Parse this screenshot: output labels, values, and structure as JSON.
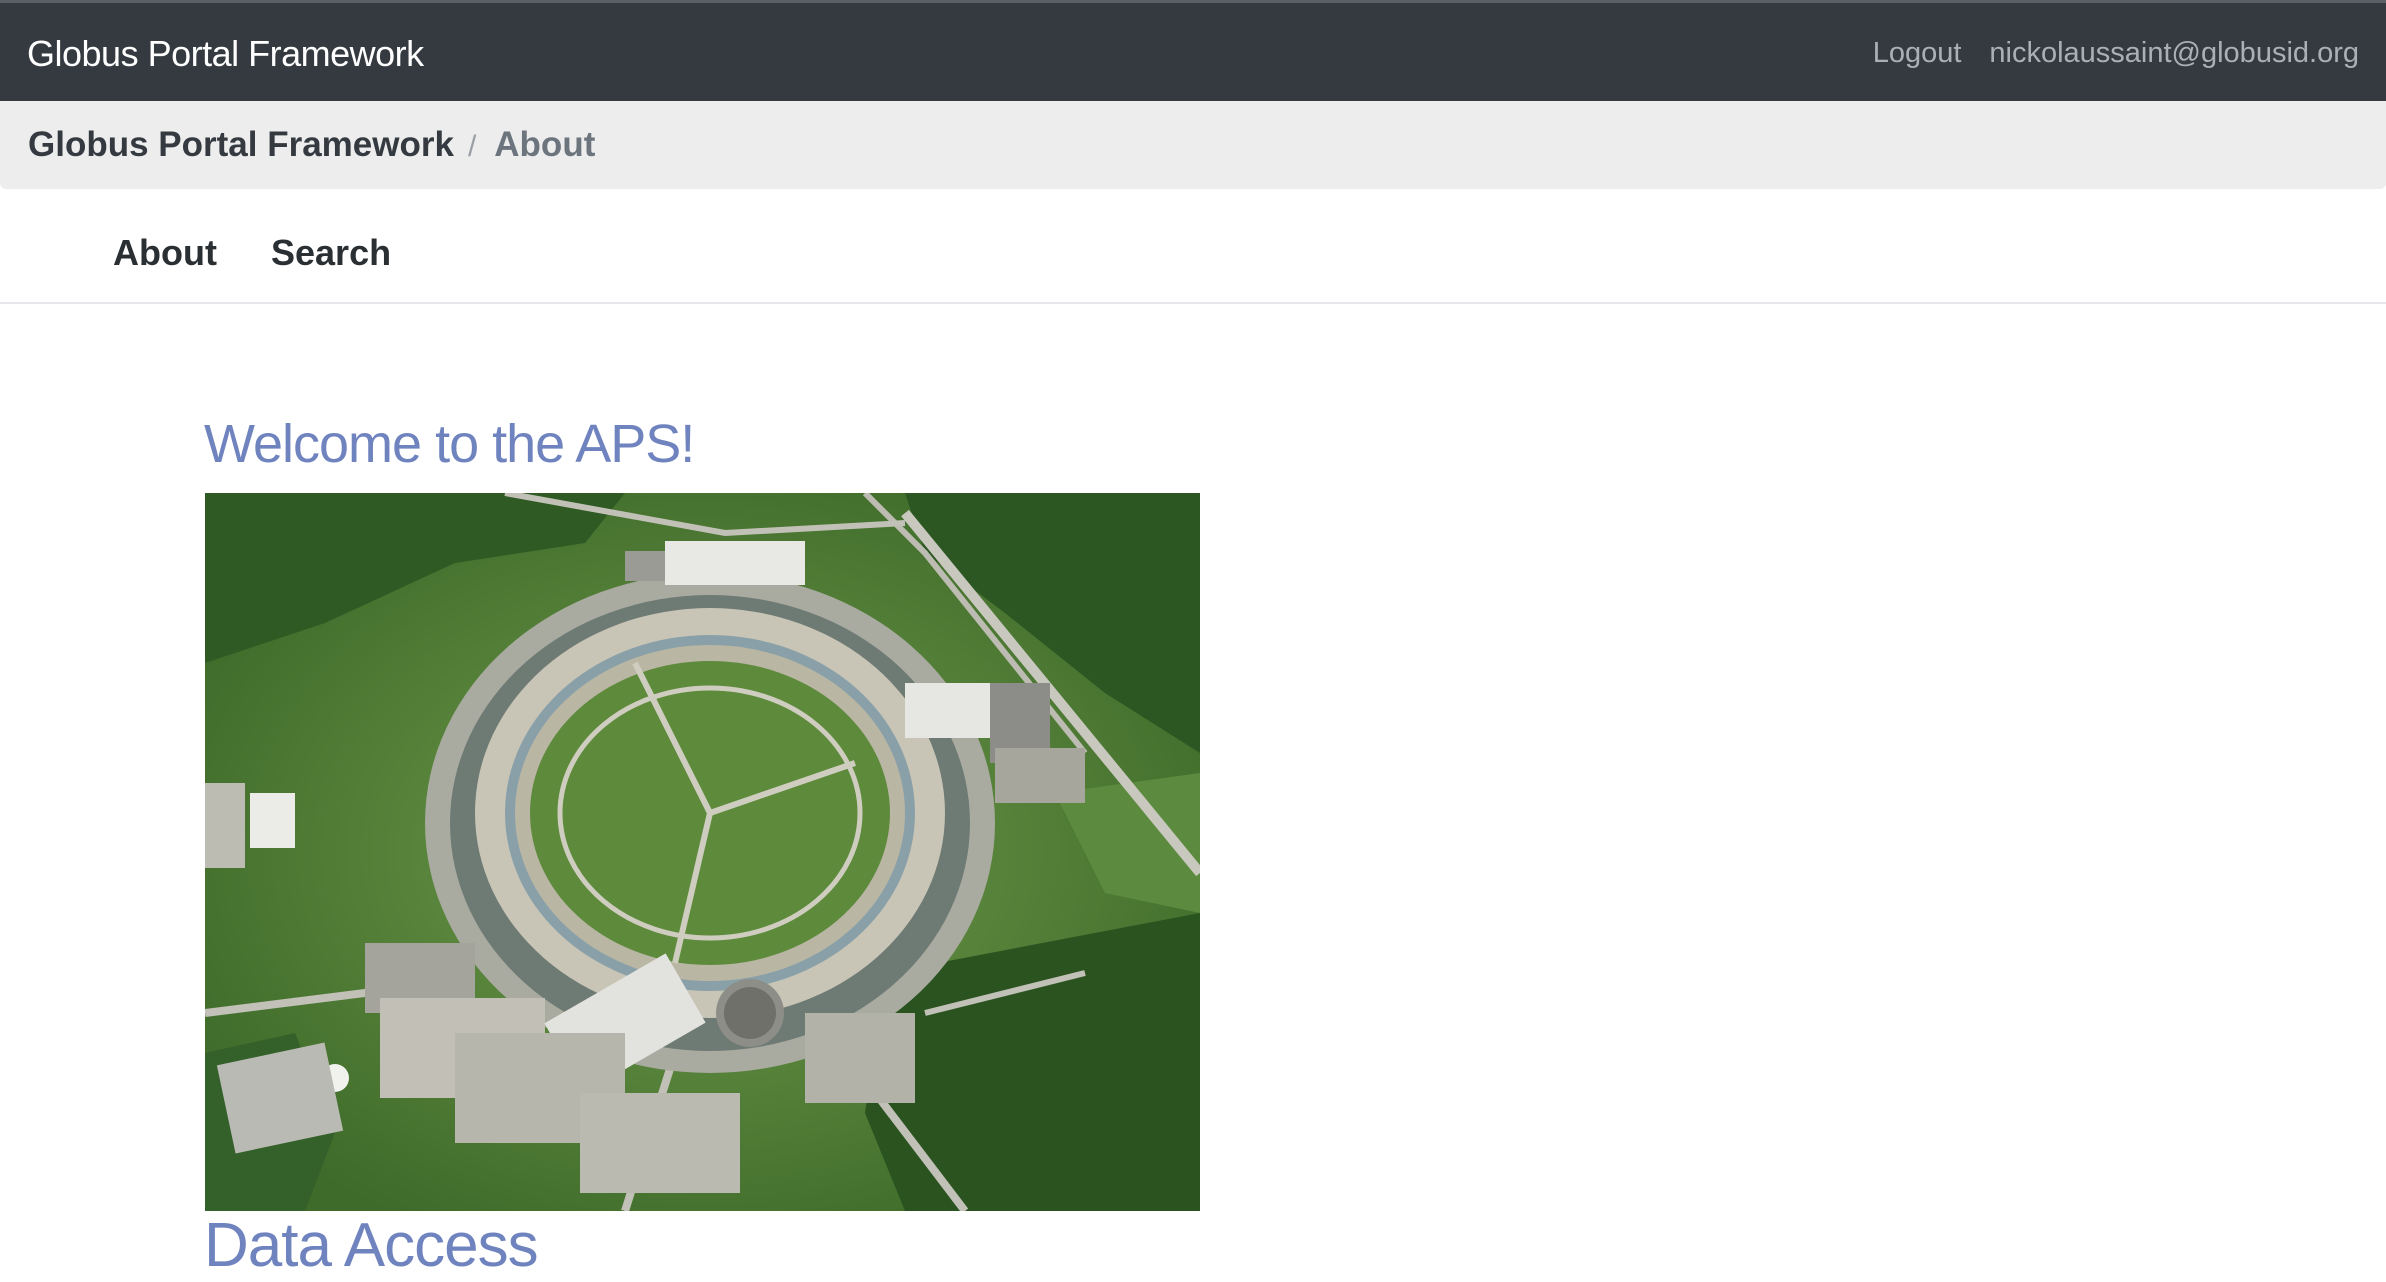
{
  "navbar": {
    "brand": "Globus Portal Framework",
    "logout_label": "Logout",
    "user_email": "nickolaussaint@globusid.org"
  },
  "breadcrumb": {
    "root": "Globus Portal Framework",
    "separator": "/",
    "current": "About"
  },
  "tabs": [
    {
      "label": "About"
    },
    {
      "label": "Search"
    }
  ],
  "main": {
    "welcome_heading": "Welcome to the APS!",
    "image_description": "aerial-photo-aps-facility",
    "data_access_heading": "Data Access"
  },
  "colors": {
    "navbar_bg": "#343a40",
    "breadcrumb_bg": "#ededee",
    "heading_accent": "#6f83bf"
  }
}
